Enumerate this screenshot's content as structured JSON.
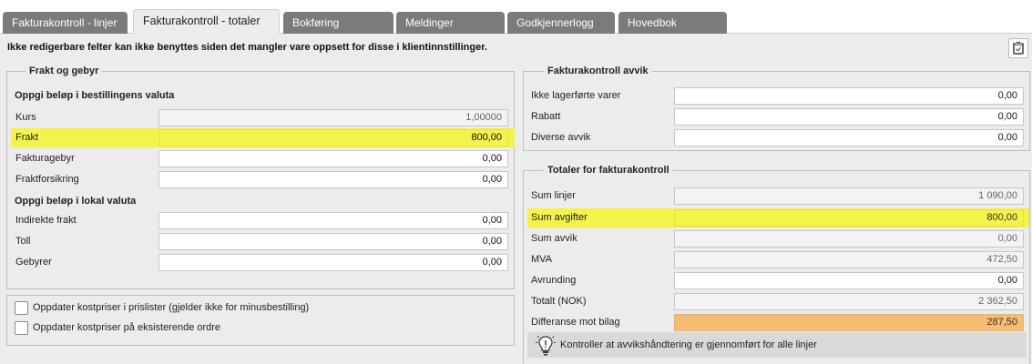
{
  "tabs": [
    {
      "label": "Fakturakontroll - linjer"
    },
    {
      "label": "Fakturakontroll - totaler"
    },
    {
      "label": "Bokføring"
    },
    {
      "label": "Meldinger"
    },
    {
      "label": "Godkjennerlogg"
    },
    {
      "label": "Hovedbok"
    }
  ],
  "info_text": "Ikke redigerbare felter kan ikke benyttes siden det mangler vare oppsett for disse i klientinnstillinger.",
  "left_panel": {
    "legend": "Frakt og gebyr",
    "section1_title": "Oppgi beløp i bestillingens valuta",
    "rows1": [
      {
        "label": "Kurs",
        "value": "1,00000"
      },
      {
        "label": "Frakt",
        "value": "800,00"
      },
      {
        "label": "Fakturagebyr",
        "value": "0,00"
      },
      {
        "label": "Fraktforsikring",
        "value": "0,00"
      }
    ],
    "section2_title": "Oppgi beløp i lokal valuta",
    "rows2": [
      {
        "label": "Indirekte frakt",
        "value": "0,00"
      },
      {
        "label": "Toll",
        "value": "0,00"
      },
      {
        "label": "Gebyrer",
        "value": "0,00"
      }
    ]
  },
  "checkboxes": [
    {
      "label": "Oppdater kostpriser i prislister (gjelder ikke for minusbestilling)",
      "checked": false
    },
    {
      "label": "Oppdater kostpriser på eksisterende ordre",
      "checked": false
    }
  ],
  "avvik_panel": {
    "legend": "Fakturakontroll avvik",
    "rows": [
      {
        "label": "Ikke lagerførte varer",
        "value": "0,00"
      },
      {
        "label": "Rabatt",
        "value": "0,00"
      },
      {
        "label": "Diverse avvik",
        "value": "0,00"
      }
    ]
  },
  "totaler_panel": {
    "legend": "Totaler for fakturakontroll",
    "rows": [
      {
        "label": "Sum linjer",
        "value": "1 090,00"
      },
      {
        "label": "Sum avgifter",
        "value": "800,00"
      },
      {
        "label": "Sum avvik",
        "value": "0,00"
      },
      {
        "label": "MVA",
        "value": "472,50"
      },
      {
        "label": "Avrunding",
        "value": "0,00"
      },
      {
        "label": "Totalt (NOK)",
        "value": "2 362,50"
      },
      {
        "label": "Differanse mot bilag",
        "value": "287,50"
      }
    ]
  },
  "notice": {
    "text": "Kontroller at avvikshåndtering er gjennomført for alle linjer",
    "icon": "lightbulb-icon"
  },
  "colors": {
    "highlight": "#f3f34a",
    "difference": "#f5bd74",
    "tab_inactive": "#7b7b7b"
  }
}
